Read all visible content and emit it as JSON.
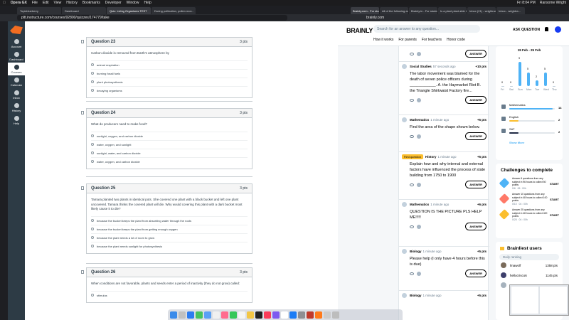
{
  "menubar": {
    "app": "Opera GX",
    "items": [
      "File",
      "Edit",
      "View",
      "History",
      "Bookmarks",
      "Developer",
      "Window",
      "Help"
    ],
    "time": "Fri 8:04 PM",
    "user": "Ransome Wright"
  },
  "left": {
    "tabs": [
      "Topicblueberry",
      "Dashboard",
      "Quiz: Living Organisms TEST",
      "During pollination, pollen mov..."
    ],
    "url": "pltt.instructure.com/courses/92800/quizzes/174779/take",
    "nav": [
      "Account",
      "Dashboard",
      "Courses",
      "Calendar",
      "Inbox",
      "History",
      "Help"
    ],
    "questions": [
      {
        "title": "Question 23",
        "pts": "3 pts",
        "text": "Carbon dioxide is removed from Earth's atmosphere by",
        "options": [
          "animal respiration",
          "burning fossil fuels",
          "plant photosynthesis",
          "decaying organisms"
        ]
      },
      {
        "title": "Question 24",
        "pts": "3 pts",
        "text": "What do producers need to make food?",
        "options": [
          "sunlight, oxygen, and carbon dioxide",
          "water, oxygen, and sunlight",
          "sunlight, water, and carbon dioxide",
          "water, oxygen, and carbon dioxide"
        ]
      },
      {
        "title": "Question 25",
        "pts": "3 pts",
        "text": "Tamara planted two plants in identical pots.  She covered one plant with a black bucket and left one plant uncovered.  Tamara thinks the covered plant will die.  Why would covering this plant with a dark bucket most likely cause it to die?",
        "options": [
          "because the bucket keeps the plant from absorbing water through the roots",
          "because the bucket keeps the plant from getting enough oxygen",
          "because the plant needs a lot of room to grow",
          "because the plant needs sunlight for photosynthesis"
        ]
      },
      {
        "title": "Question 26",
        "pts": "3 pts",
        "text": "When conditions are not favorable, plants and seeds enter a period of inactivity (they do not grow) called:",
        "options": [
          "stimulus"
        ]
      }
    ]
  },
  "right": {
    "tabs": [
      "Brainly.com - For stud...",
      "All of the following are...",
      "Brainly.in - For student...",
      "Is a plant plant able to...",
      "Inbox (21) - wrightram...",
      "Inbox - wrightra..."
    ],
    "url": "brainly.com",
    "logo": "BRAINLY",
    "search_placeholder": "Search for an answer to any question...",
    "ask": "ASK QUESTION",
    "nav": [
      "How it works",
      "For parents",
      "For teachers",
      "Honor code"
    ],
    "answer_label": "ANSWER",
    "cards": [
      {
        "subject": "Social Studies",
        "time": "57 seconds ago",
        "points": "+10 pts",
        "text": "The labor movement was blamed for the death of seven police officers during ____________. A. the Haymarket Riot B. the Triangle Shirtwaist Factory fire..."
      },
      {
        "subject": "Mathematics",
        "time": "1 minute ago",
        "points": "+5 pts",
        "text": "Find the area of the shape shown below."
      },
      {
        "badge": "First question",
        "subject": "History",
        "time": "1 minute ago",
        "points": "+5 pts",
        "text": "Explain how and why internal and external factors have influenced the process of state building from 1750 to 1900"
      },
      {
        "subject": "Mathematics",
        "time": "1 minute ago",
        "points": "+6 pts",
        "text": "QUESTION IS THE PICTURE PLS HELP ME!!!!!"
      },
      {
        "subject": "Biology",
        "time": "1 minute ago",
        "points": "+5 pts",
        "text": "Please help (I only have 4 hours before this is due)"
      },
      {
        "subject": "Biology",
        "time": "1 minute ago",
        "points": "+5 pts",
        "text": ""
      }
    ],
    "stats": {
      "week": "19 Feb - 25 Feb",
      "days": [
        "Fri",
        "Sat",
        "Sun",
        "Mon",
        "Tue",
        "Wed",
        "Thu"
      ],
      "counts": [
        "0",
        "0",
        "9",
        "5",
        "2",
        "5",
        "0"
      ],
      "subjects": [
        {
          "name": "Mathematics",
          "count": "14",
          "color": "#4fb3f6",
          "fill": 0.95
        },
        {
          "name": "English",
          "count": "2",
          "color": "#fbbe2e",
          "fill": 0.2
        },
        {
          "name": "SAT",
          "count": "2",
          "color": "#1f2a44",
          "fill": 0.2
        }
      ],
      "show_more": "Show More"
    },
    "challenges": {
      "title": "Challenges to complete",
      "start": "START",
      "items": [
        {
          "text": "Answer 6 questions from any subject in 96 hours to collect 50 points",
          "progress": "0/6",
          "time": "06 : 00h",
          "color": "#4fb3f6"
        },
        {
          "text": "Answer 10 questions from any subject in 48 hours to collect 100 points",
          "progress": "0/10",
          "time": "04 : 00h",
          "color": "#ff7968"
        },
        {
          "text": "Answer 25 questions from any subject in 48 hours to collect 400 points",
          "progress": "0/25",
          "time": "04 : 00h",
          "color": "#fbbe2e"
        }
      ]
    },
    "brainliest": {
      "title": "Brainliest users",
      "ranking": "Daily ranking",
      "users": [
        {
          "name": "lmawolf",
          "pts": "1358 pts"
        },
        {
          "name": "hellocrisco6",
          "pts": "1145 pts"
        },
        {
          "name": "",
          "pts": ""
        }
      ]
    }
  }
}
